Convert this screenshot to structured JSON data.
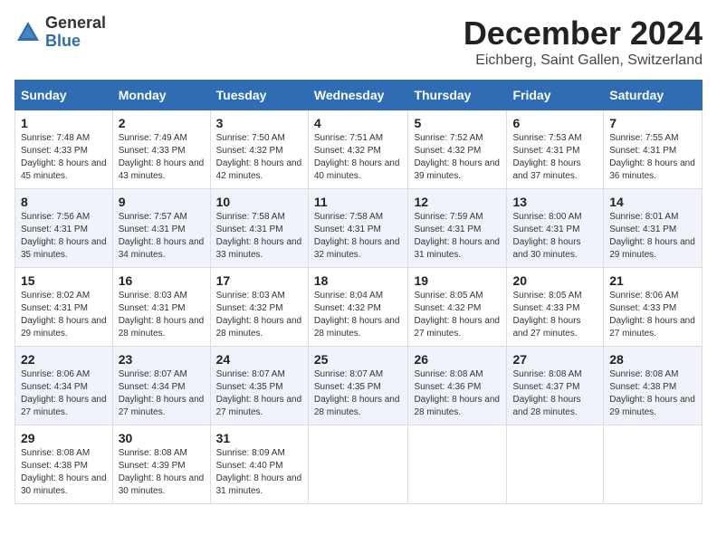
{
  "logo": {
    "general": "General",
    "blue": "Blue"
  },
  "title": "December 2024",
  "location": "Eichberg, Saint Gallen, Switzerland",
  "days_of_week": [
    "Sunday",
    "Monday",
    "Tuesday",
    "Wednesday",
    "Thursday",
    "Friday",
    "Saturday"
  ],
  "weeks": [
    [
      {
        "day": "1",
        "sunrise": "Sunrise: 7:48 AM",
        "sunset": "Sunset: 4:33 PM",
        "daylight": "Daylight: 8 hours and 45 minutes."
      },
      {
        "day": "2",
        "sunrise": "Sunrise: 7:49 AM",
        "sunset": "Sunset: 4:33 PM",
        "daylight": "Daylight: 8 hours and 43 minutes."
      },
      {
        "day": "3",
        "sunrise": "Sunrise: 7:50 AM",
        "sunset": "Sunset: 4:32 PM",
        "daylight": "Daylight: 8 hours and 42 minutes."
      },
      {
        "day": "4",
        "sunrise": "Sunrise: 7:51 AM",
        "sunset": "Sunset: 4:32 PM",
        "daylight": "Daylight: 8 hours and 40 minutes."
      },
      {
        "day": "5",
        "sunrise": "Sunrise: 7:52 AM",
        "sunset": "Sunset: 4:32 PM",
        "daylight": "Daylight: 8 hours and 39 minutes."
      },
      {
        "day": "6",
        "sunrise": "Sunrise: 7:53 AM",
        "sunset": "Sunset: 4:31 PM",
        "daylight": "Daylight: 8 hours and 37 minutes."
      },
      {
        "day": "7",
        "sunrise": "Sunrise: 7:55 AM",
        "sunset": "Sunset: 4:31 PM",
        "daylight": "Daylight: 8 hours and 36 minutes."
      }
    ],
    [
      {
        "day": "8",
        "sunrise": "Sunrise: 7:56 AM",
        "sunset": "Sunset: 4:31 PM",
        "daylight": "Daylight: 8 hours and 35 minutes."
      },
      {
        "day": "9",
        "sunrise": "Sunrise: 7:57 AM",
        "sunset": "Sunset: 4:31 PM",
        "daylight": "Daylight: 8 hours and 34 minutes."
      },
      {
        "day": "10",
        "sunrise": "Sunrise: 7:58 AM",
        "sunset": "Sunset: 4:31 PM",
        "daylight": "Daylight: 8 hours and 33 minutes."
      },
      {
        "day": "11",
        "sunrise": "Sunrise: 7:58 AM",
        "sunset": "Sunset: 4:31 PM",
        "daylight": "Daylight: 8 hours and 32 minutes."
      },
      {
        "day": "12",
        "sunrise": "Sunrise: 7:59 AM",
        "sunset": "Sunset: 4:31 PM",
        "daylight": "Daylight: 8 hours and 31 minutes."
      },
      {
        "day": "13",
        "sunrise": "Sunrise: 8:00 AM",
        "sunset": "Sunset: 4:31 PM",
        "daylight": "Daylight: 8 hours and 30 minutes."
      },
      {
        "day": "14",
        "sunrise": "Sunrise: 8:01 AM",
        "sunset": "Sunset: 4:31 PM",
        "daylight": "Daylight: 8 hours and 29 minutes."
      }
    ],
    [
      {
        "day": "15",
        "sunrise": "Sunrise: 8:02 AM",
        "sunset": "Sunset: 4:31 PM",
        "daylight": "Daylight: 8 hours and 29 minutes."
      },
      {
        "day": "16",
        "sunrise": "Sunrise: 8:03 AM",
        "sunset": "Sunset: 4:31 PM",
        "daylight": "Daylight: 8 hours and 28 minutes."
      },
      {
        "day": "17",
        "sunrise": "Sunrise: 8:03 AM",
        "sunset": "Sunset: 4:32 PM",
        "daylight": "Daylight: 8 hours and 28 minutes."
      },
      {
        "day": "18",
        "sunrise": "Sunrise: 8:04 AM",
        "sunset": "Sunset: 4:32 PM",
        "daylight": "Daylight: 8 hours and 28 minutes."
      },
      {
        "day": "19",
        "sunrise": "Sunrise: 8:05 AM",
        "sunset": "Sunset: 4:32 PM",
        "daylight": "Daylight: 8 hours and 27 minutes."
      },
      {
        "day": "20",
        "sunrise": "Sunrise: 8:05 AM",
        "sunset": "Sunset: 4:33 PM",
        "daylight": "Daylight: 8 hours and 27 minutes."
      },
      {
        "day": "21",
        "sunrise": "Sunrise: 8:06 AM",
        "sunset": "Sunset: 4:33 PM",
        "daylight": "Daylight: 8 hours and 27 minutes."
      }
    ],
    [
      {
        "day": "22",
        "sunrise": "Sunrise: 8:06 AM",
        "sunset": "Sunset: 4:34 PM",
        "daylight": "Daylight: 8 hours and 27 minutes."
      },
      {
        "day": "23",
        "sunrise": "Sunrise: 8:07 AM",
        "sunset": "Sunset: 4:34 PM",
        "daylight": "Daylight: 8 hours and 27 minutes."
      },
      {
        "day": "24",
        "sunrise": "Sunrise: 8:07 AM",
        "sunset": "Sunset: 4:35 PM",
        "daylight": "Daylight: 8 hours and 27 minutes."
      },
      {
        "day": "25",
        "sunrise": "Sunrise: 8:07 AM",
        "sunset": "Sunset: 4:35 PM",
        "daylight": "Daylight: 8 hours and 28 minutes."
      },
      {
        "day": "26",
        "sunrise": "Sunrise: 8:08 AM",
        "sunset": "Sunset: 4:36 PM",
        "daylight": "Daylight: 8 hours and 28 minutes."
      },
      {
        "day": "27",
        "sunrise": "Sunrise: 8:08 AM",
        "sunset": "Sunset: 4:37 PM",
        "daylight": "Daylight: 8 hours and 28 minutes."
      },
      {
        "day": "28",
        "sunrise": "Sunrise: 8:08 AM",
        "sunset": "Sunset: 4:38 PM",
        "daylight": "Daylight: 8 hours and 29 minutes."
      }
    ],
    [
      {
        "day": "29",
        "sunrise": "Sunrise: 8:08 AM",
        "sunset": "Sunset: 4:38 PM",
        "daylight": "Daylight: 8 hours and 30 minutes."
      },
      {
        "day": "30",
        "sunrise": "Sunrise: 8:08 AM",
        "sunset": "Sunset: 4:39 PM",
        "daylight": "Daylight: 8 hours and 30 minutes."
      },
      {
        "day": "31",
        "sunrise": "Sunrise: 8:09 AM",
        "sunset": "Sunset: 4:40 PM",
        "daylight": "Daylight: 8 hours and 31 minutes."
      },
      null,
      null,
      null,
      null
    ]
  ]
}
